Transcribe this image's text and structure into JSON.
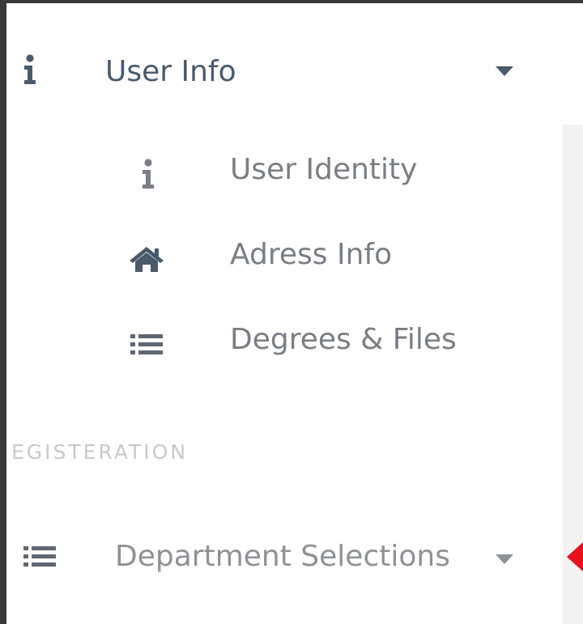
{
  "sidebar": {
    "user_info": {
      "label": "User Info",
      "icon": "info-icon",
      "caret": "caret-down-icon"
    },
    "children": [
      {
        "label": "User Identity",
        "icon": "info-icon"
      },
      {
        "label": "Adress Info",
        "icon": "home-icon"
      },
      {
        "label": "Degrees & Files",
        "icon": "list-icon"
      }
    ],
    "section_title": "EGISTERATION",
    "department": {
      "label": "Department Selections",
      "icon": "list-icon",
      "caret": "caret-down-icon"
    }
  },
  "colors": {
    "parent_text": "#4a5a6d",
    "child_text": "#7a7e85",
    "section_text": "#c7c9cc",
    "icon_dark": "#4a5a6d",
    "pointer": "#e8101b"
  }
}
